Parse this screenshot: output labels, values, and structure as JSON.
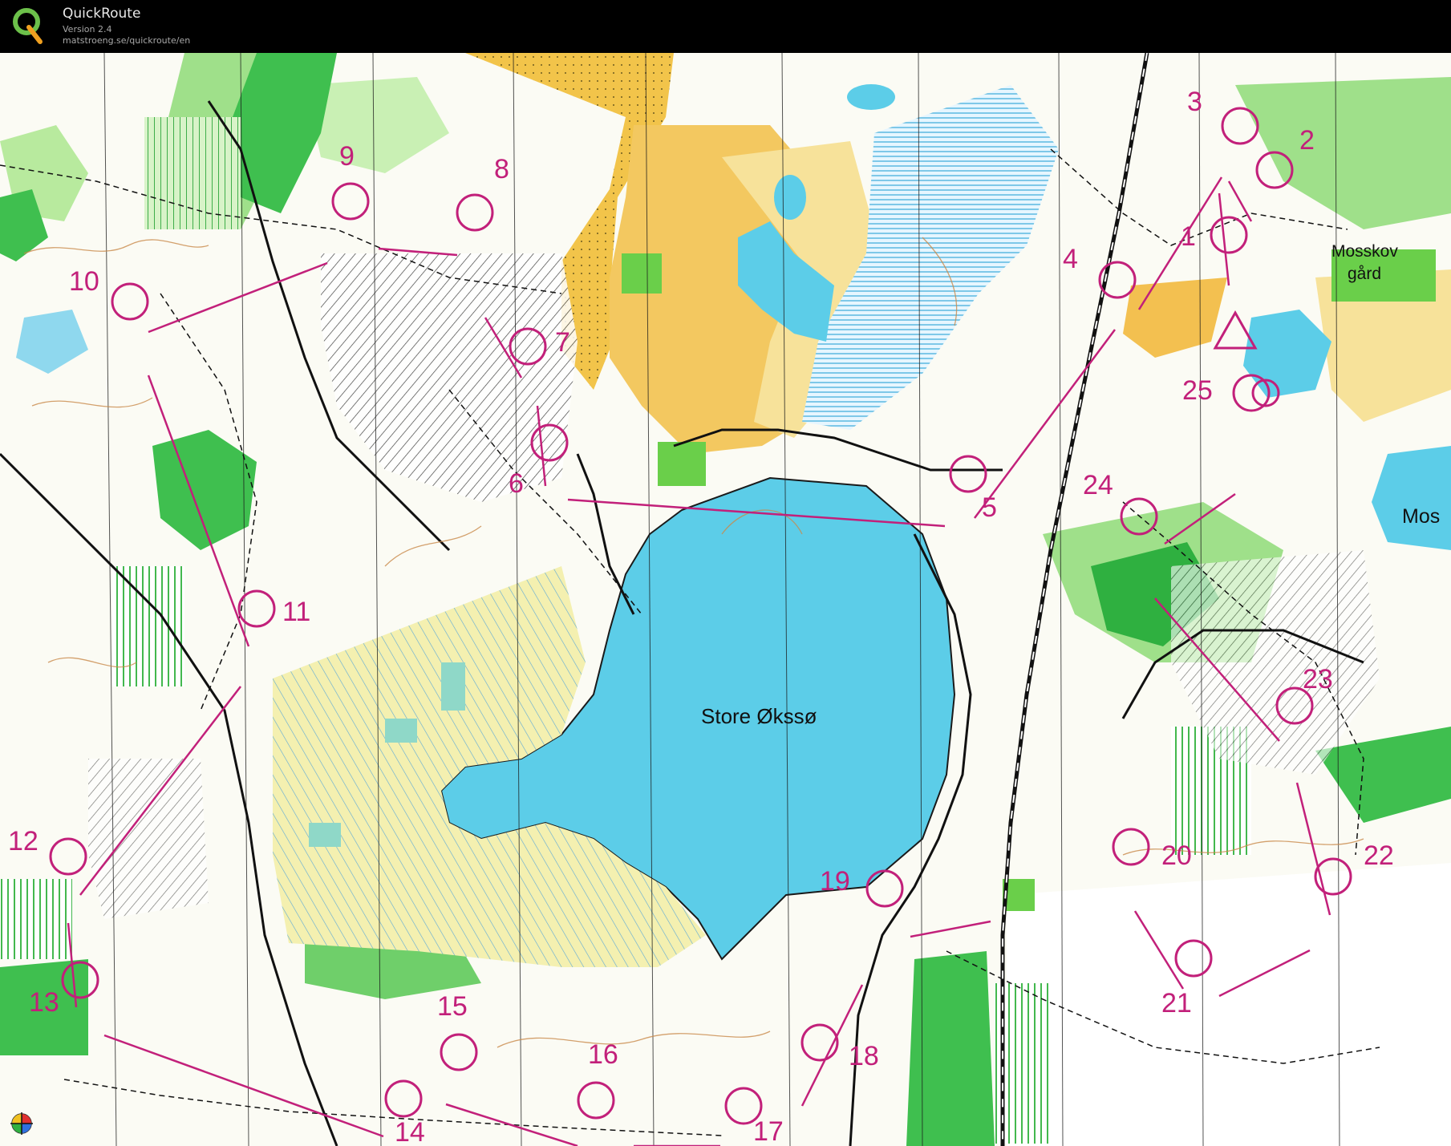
{
  "app": {
    "title": "QuickRoute",
    "version": "Version 2.4",
    "url": "matstroeng.se/quickroute/en"
  },
  "map": {
    "lake_label": "Store Økssø",
    "farm_label_line1": "Mosskov",
    "farm_label_line2": "gård",
    "edge_label": "Mos",
    "controls": [
      {
        "num": "1"
      },
      {
        "num": "2"
      },
      {
        "num": "3"
      },
      {
        "num": "4"
      },
      {
        "num": "5"
      },
      {
        "num": "6"
      },
      {
        "num": "7"
      },
      {
        "num": "8"
      },
      {
        "num": "9"
      },
      {
        "num": "10"
      },
      {
        "num": "11"
      },
      {
        "num": "12"
      },
      {
        "num": "13"
      },
      {
        "num": "14"
      },
      {
        "num": "15"
      },
      {
        "num": "16"
      },
      {
        "num": "17"
      },
      {
        "num": "18"
      },
      {
        "num": "19"
      },
      {
        "num": "20"
      },
      {
        "num": "21"
      },
      {
        "num": "22"
      },
      {
        "num": "23"
      },
      {
        "num": "24"
      },
      {
        "num": "25"
      }
    ],
    "colors": {
      "water": "#5ccde8",
      "forest_green": "#3fbf4f",
      "light_green": "#9fe08a",
      "open_yellow": "#f2c44a",
      "rough_yellow": "#f6e79a",
      "course_magenta": "#c2207a",
      "contour_brown": "#c98a4a"
    }
  }
}
